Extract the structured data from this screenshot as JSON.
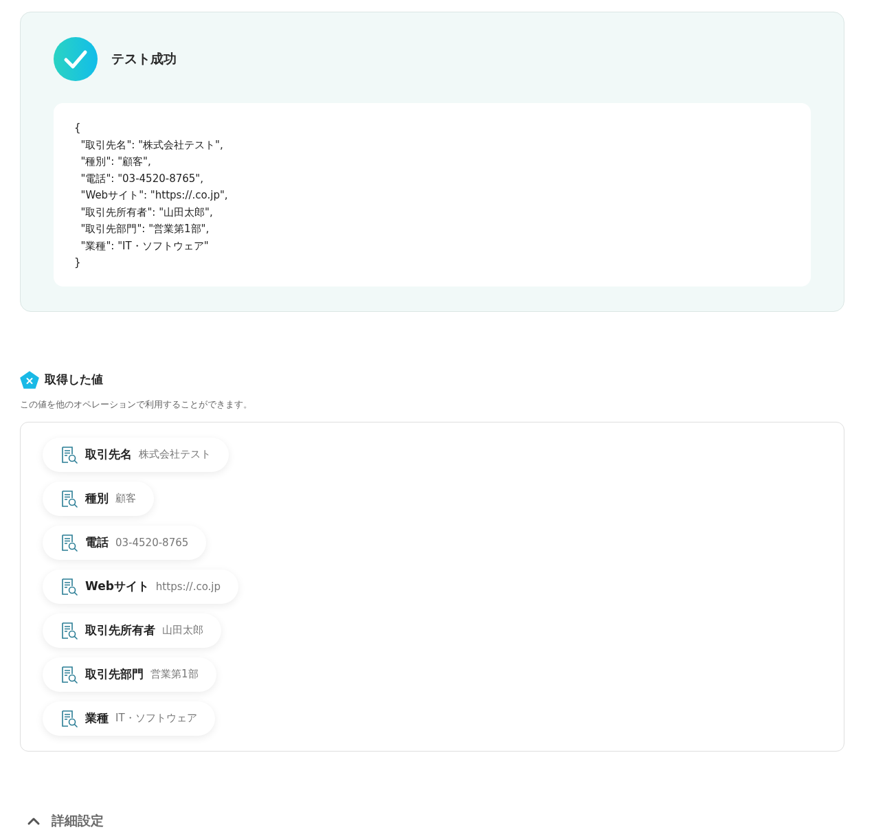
{
  "test_result": {
    "title": "テスト成功",
    "success": true,
    "code_lines": [
      "{",
      "  \"取引先名\": \"株式会社テスト\",",
      "  \"種別\": \"顧客\",",
      "  \"電話\": \"03-4520-8765\",",
      "  \"Webサイト\": \"https://.co.jp\",",
      "  \"取引先所有者\": \"山田太郎\",",
      "  \"取引先部門\": \"営業第1部\",",
      "  \"業種\": \"IT・ソフトウェア\"",
      "}"
    ]
  },
  "values_section": {
    "title": "取得した値",
    "description": "この値を他のオペレーションで利用することができます。",
    "items": [
      {
        "name": "取引先名",
        "value": "株式会社テスト"
      },
      {
        "name": "種別",
        "value": "顧客"
      },
      {
        "name": "電話",
        "value": "03-4520-8765"
      },
      {
        "name": "Webサイト",
        "value": "https://.co.jp"
      },
      {
        "name": "取引先所有者",
        "value": "山田太郎"
      },
      {
        "name": "取引先部門",
        "value": "営業第1部"
      },
      {
        "name": "業種",
        "value": "IT・ソフトウェア"
      }
    ]
  },
  "details": {
    "label": "詳細設定",
    "expanded": true
  }
}
